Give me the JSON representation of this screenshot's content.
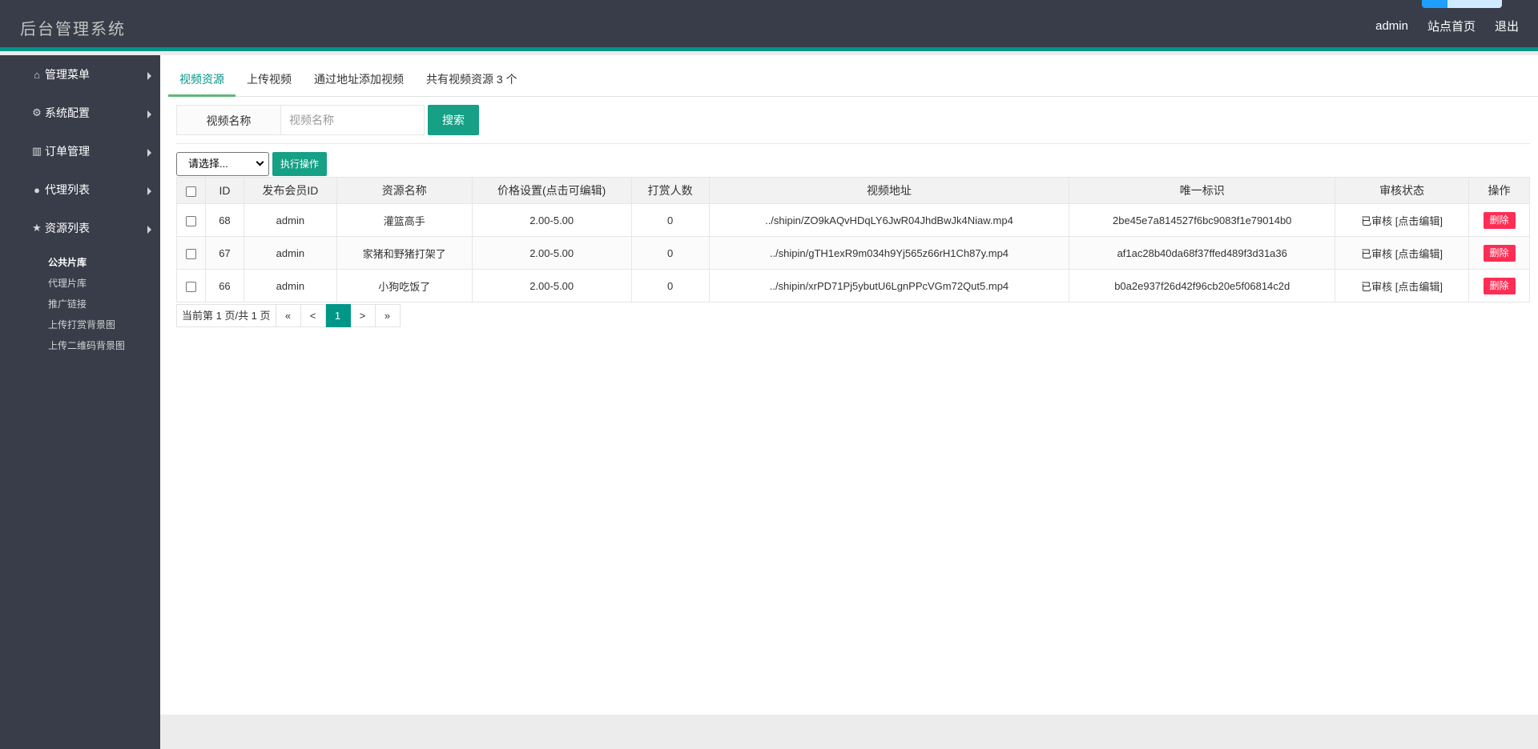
{
  "header": {
    "title": "后台管理系统",
    "nav": [
      "admin",
      "站点首页",
      "退出"
    ]
  },
  "sidebar": {
    "items": [
      {
        "label": "管理菜单",
        "icon": "home-icon",
        "glyph": "⌂"
      },
      {
        "label": "系统配置",
        "icon": "cogs-icon",
        "glyph": "⚙"
      },
      {
        "label": "订单管理",
        "icon": "bar-chart-icon",
        "glyph": "▥"
      },
      {
        "label": "代理列表",
        "icon": "user-icon",
        "glyph": "●"
      },
      {
        "label": "资源列表",
        "icon": "star-icon",
        "glyph": "★"
      }
    ],
    "submenu": [
      "公共片库",
      "代理片库",
      "推广链接",
      "上传打赏背景图",
      "上传二维码背景图"
    ]
  },
  "tabs": [
    "视频资源",
    "上传视频",
    "通过地址添加视频",
    "共有视频资源 3 个"
  ],
  "search": {
    "label": "视频名称",
    "placeholder": "视频名称",
    "button": "搜索"
  },
  "actions": {
    "select_value": "请选择...",
    "button": "执行操作"
  },
  "table": {
    "columns": [
      "ID",
      "发布会员ID",
      "资源名称",
      "价格设置(点击可编辑)",
      "打赏人数",
      "视频地址",
      "唯一标识",
      "审核状态",
      "操作"
    ],
    "rows": [
      {
        "id": "68",
        "member": "admin",
        "name": "灌篮高手",
        "price": "2.00-5.00",
        "donors": "0",
        "url": "../shipin/ZO9kAQvHDqLY6JwR04JhdBwJk4Niaw.mp4",
        "uid": "2be45e7a814527f6bc9083f1e79014b0",
        "status": "已审核",
        "edit": "[点击编辑]",
        "op": "删除"
      },
      {
        "id": "67",
        "member": "admin",
        "name": "家猪和野猪打架了",
        "price": "2.00-5.00",
        "donors": "0",
        "url": "../shipin/gTH1exR9m034h9Yj565z66rH1Ch87y.mp4",
        "uid": "af1ac28b40da68f37ffed489f3d31a36",
        "status": "已审核",
        "edit": "[点击编辑]",
        "op": "删除"
      },
      {
        "id": "66",
        "member": "admin",
        "name": "小狗吃饭了",
        "price": "2.00-5.00",
        "donors": "0",
        "url": "../shipin/xrPD71Pj5ybutU6LgnPPcVGm72Qut5.mp4",
        "uid": "b0a2e937f26d42f96cb20e5f06814c2d",
        "status": "已审核",
        "edit": "[点击编辑]",
        "op": "删除"
      }
    ]
  },
  "pager": {
    "info": "当前第 1 页/共 1 页",
    "first": "«",
    "prev": "<",
    "current": "1",
    "next": ">",
    "last": "»"
  },
  "colors": {
    "header_bg": "#393d49",
    "accent": "#009688",
    "button": "#16a085",
    "danger": "#ff2d55"
  }
}
